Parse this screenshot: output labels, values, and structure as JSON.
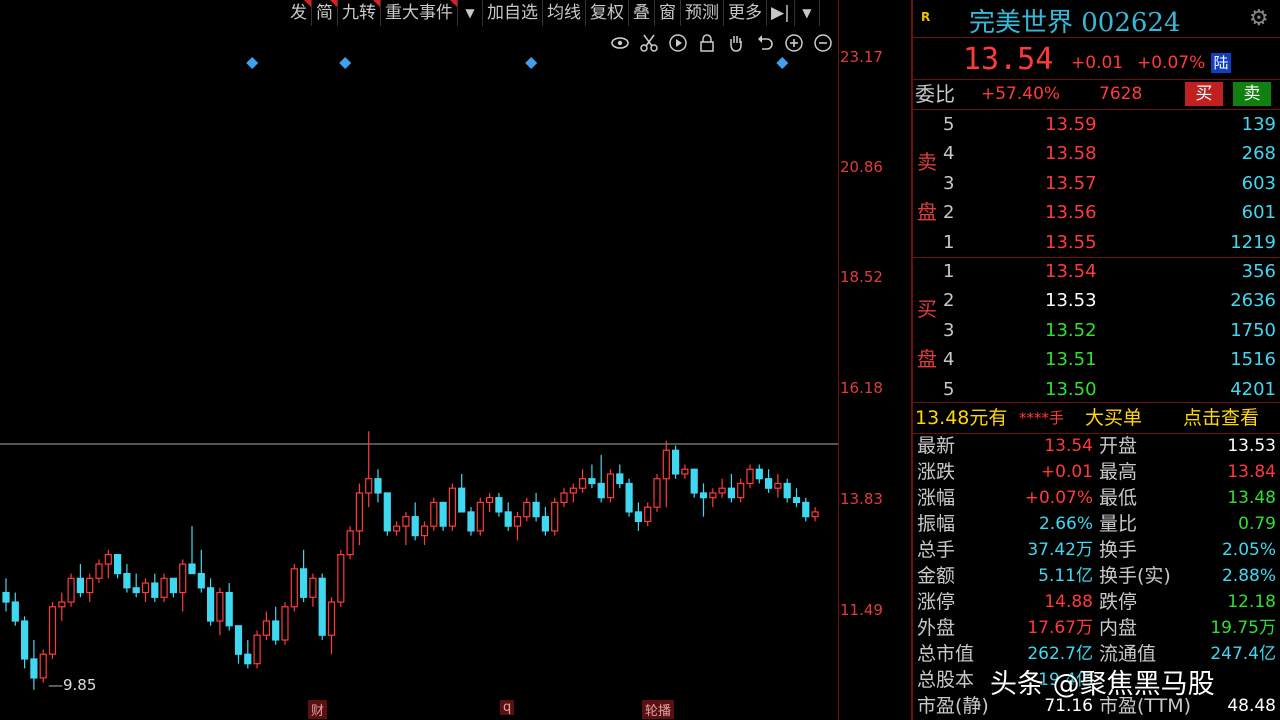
{
  "toolbar": {
    "buttons": [
      {
        "label": "发",
        "flag": true
      },
      {
        "label": "简",
        "flag": true
      },
      {
        "label": "九转",
        "flag": true
      },
      {
        "label": "重大事件",
        "flag": true
      },
      {
        "label": "▼",
        "flag": false
      },
      {
        "label": "加自选",
        "flag": false
      },
      {
        "label": "均线",
        "flag": false
      },
      {
        "label": "复权",
        "flag": false
      },
      {
        "label": "叠",
        "flag": false
      },
      {
        "label": "窗",
        "flag": false
      },
      {
        "label": "预测",
        "flag": false
      },
      {
        "label": "更多",
        "flag": false
      },
      {
        "label": "▶|",
        "flag": false
      },
      {
        "label": "▼",
        "flag": false
      }
    ],
    "tool_icons": [
      "eye-icon",
      "scissors-icon",
      "play-icon",
      "lock-icon",
      "hand-icon",
      "undo-icon",
      "zoom-in-icon",
      "zoom-out-icon"
    ]
  },
  "chart": {
    "price_ticks": [
      "23.17",
      "20.86",
      "18.52",
      "16.18",
      "13.83",
      "11.49"
    ],
    "low_marker": "9.85",
    "x_markers": [
      "财",
      "q",
      "轮播"
    ],
    "colors": {
      "up": "#ff3a3a",
      "down": "#40d8f0",
      "marker": "#40a0f0",
      "axis": "#e03c3c"
    }
  },
  "chart_data": {
    "type": "candlestick",
    "ylim": [
      9.5,
      23.5
    ],
    "candles": [
      [
        11.9,
        12.2,
        11.5,
        11.7
      ],
      [
        11.7,
        11.9,
        11.2,
        11.3
      ],
      [
        11.3,
        11.4,
        10.3,
        10.5
      ],
      [
        10.5,
        10.9,
        9.85,
        10.1
      ],
      [
        10.1,
        10.7,
        10.0,
        10.6
      ],
      [
        10.6,
        11.7,
        10.5,
        11.6
      ],
      [
        11.6,
        11.9,
        11.3,
        11.7
      ],
      [
        11.7,
        12.3,
        11.6,
        12.2
      ],
      [
        12.2,
        12.5,
        11.8,
        11.9
      ],
      [
        11.9,
        12.3,
        11.7,
        12.2
      ],
      [
        12.2,
        12.6,
        12.1,
        12.5
      ],
      [
        12.5,
        12.8,
        12.2,
        12.7
      ],
      [
        12.7,
        12.7,
        12.2,
        12.3
      ],
      [
        12.3,
        12.5,
        11.9,
        12.0
      ],
      [
        12.0,
        12.3,
        11.8,
        11.9
      ],
      [
        11.9,
        12.2,
        11.7,
        12.1
      ],
      [
        12.1,
        12.3,
        11.7,
        11.8
      ],
      [
        11.8,
        12.3,
        11.7,
        12.2
      ],
      [
        12.2,
        12.2,
        11.8,
        11.9
      ],
      [
        11.9,
        12.6,
        11.5,
        12.5
      ],
      [
        12.5,
        13.3,
        12.3,
        12.3
      ],
      [
        12.3,
        12.8,
        11.9,
        12.0
      ],
      [
        12.0,
        12.2,
        11.2,
        11.3
      ],
      [
        11.3,
        12.0,
        11.0,
        11.9
      ],
      [
        11.9,
        12.1,
        11.1,
        11.2
      ],
      [
        11.2,
        11.2,
        10.4,
        10.6
      ],
      [
        10.6,
        10.9,
        10.3,
        10.4
      ],
      [
        10.4,
        11.1,
        10.3,
        11.0
      ],
      [
        11.0,
        11.5,
        10.9,
        11.3
      ],
      [
        11.3,
        11.6,
        10.8,
        10.9
      ],
      [
        10.9,
        11.7,
        10.8,
        11.6
      ],
      [
        11.6,
        12.5,
        11.5,
        12.4
      ],
      [
        12.4,
        12.8,
        11.7,
        11.8
      ],
      [
        11.8,
        12.3,
        11.6,
        12.2
      ],
      [
        12.2,
        12.3,
        10.9,
        11.0
      ],
      [
        11.0,
        11.8,
        10.6,
        11.7
      ],
      [
        11.7,
        12.8,
        11.6,
        12.7
      ],
      [
        12.7,
        13.3,
        12.6,
        13.2
      ],
      [
        13.2,
        14.2,
        12.9,
        14.0
      ],
      [
        14.0,
        15.3,
        13.7,
        14.3
      ],
      [
        14.3,
        14.5,
        13.8,
        14.0
      ],
      [
        14.0,
        14.0,
        13.1,
        13.2
      ],
      [
        13.2,
        13.4,
        13.1,
        13.3
      ],
      [
        13.3,
        13.6,
        12.9,
        13.5
      ],
      [
        13.5,
        13.8,
        13.0,
        13.1
      ],
      [
        13.1,
        13.4,
        12.9,
        13.3
      ],
      [
        13.3,
        13.9,
        13.2,
        13.8
      ],
      [
        13.8,
        13.8,
        13.2,
        13.3
      ],
      [
        13.3,
        14.2,
        13.2,
        14.1
      ],
      [
        14.1,
        14.4,
        13.6,
        13.6
      ],
      [
        13.6,
        13.7,
        13.1,
        13.2
      ],
      [
        13.2,
        13.9,
        13.1,
        13.8
      ],
      [
        13.8,
        14.0,
        13.6,
        13.9
      ],
      [
        13.9,
        14.0,
        13.5,
        13.6
      ],
      [
        13.6,
        13.8,
        13.2,
        13.3
      ],
      [
        13.3,
        13.6,
        13.0,
        13.5
      ],
      [
        13.5,
        13.9,
        13.4,
        13.8
      ],
      [
        13.8,
        14.0,
        13.4,
        13.5
      ],
      [
        13.5,
        13.7,
        13.1,
        13.2
      ],
      [
        13.2,
        13.9,
        13.1,
        13.8
      ],
      [
        13.8,
        14.1,
        13.7,
        14.0
      ],
      [
        14.0,
        14.2,
        13.8,
        14.1
      ],
      [
        14.1,
        14.5,
        14.0,
        14.3
      ],
      [
        14.3,
        14.6,
        14.1,
        14.2
      ],
      [
        14.2,
        14.8,
        13.8,
        13.9
      ],
      [
        13.9,
        14.5,
        13.8,
        14.4
      ],
      [
        14.4,
        14.6,
        14.1,
        14.2
      ],
      [
        14.2,
        14.3,
        13.5,
        13.6
      ],
      [
        13.6,
        13.8,
        13.2,
        13.4
      ],
      [
        13.4,
        13.8,
        13.3,
        13.7
      ],
      [
        13.7,
        14.4,
        13.6,
        14.3
      ],
      [
        14.3,
        15.1,
        13.7,
        14.9
      ],
      [
        14.9,
        15.0,
        14.3,
        14.4
      ],
      [
        14.4,
        14.6,
        14.3,
        14.5
      ],
      [
        14.5,
        14.5,
        13.9,
        14.0
      ],
      [
        14.0,
        14.2,
        13.5,
        13.9
      ],
      [
        13.9,
        14.1,
        13.7,
        14.0
      ],
      [
        14.0,
        14.3,
        13.9,
        14.1
      ],
      [
        14.1,
        14.4,
        13.8,
        13.9
      ],
      [
        13.9,
        14.3,
        13.8,
        14.2
      ],
      [
        14.2,
        14.6,
        14.1,
        14.5
      ],
      [
        14.5,
        14.6,
        14.2,
        14.3
      ],
      [
        14.3,
        14.5,
        14.0,
        14.1
      ],
      [
        14.1,
        14.4,
        13.9,
        14.2
      ],
      [
        14.2,
        14.3,
        13.8,
        13.9
      ],
      [
        13.9,
        14.1,
        13.7,
        13.8
      ],
      [
        13.8,
        13.9,
        13.4,
        13.5
      ],
      [
        13.5,
        13.7,
        13.4,
        13.6
      ]
    ],
    "event_markers": [
      34,
      44,
      64,
      91,
      101,
      104,
      105
    ]
  },
  "panel": {
    "badge": "R",
    "name": "完美世界 002624",
    "price": "13.54",
    "change": "+0.01",
    "change_pct": "+0.07%",
    "market_tag": "陆",
    "weibi_label": "委比",
    "weibi_pct": "+57.40%",
    "weibi_val": "7628",
    "buy_btn": "买",
    "sell_btn": "卖",
    "sell_label_1": "卖",
    "sell_label_2": "盘",
    "buy_label_1": "买",
    "buy_label_2": "盘",
    "asks": [
      {
        "lvl": "5",
        "price": "13.59",
        "vol": "139"
      },
      {
        "lvl": "4",
        "price": "13.58",
        "vol": "268"
      },
      {
        "lvl": "3",
        "price": "13.57",
        "vol": "603"
      },
      {
        "lvl": "2",
        "price": "13.56",
        "vol": "601"
      },
      {
        "lvl": "1",
        "price": "13.55",
        "vol": "1219"
      }
    ],
    "bids": [
      {
        "lvl": "1",
        "price": "13.54",
        "vol": "356"
      },
      {
        "lvl": "2",
        "price": "13.53",
        "vol": "2636"
      },
      {
        "lvl": "3",
        "price": "13.52",
        "vol": "1750"
      },
      {
        "lvl": "4",
        "price": "13.51",
        "vol": "1516"
      },
      {
        "lvl": "5",
        "price": "13.50",
        "vol": "4201"
      }
    ],
    "big_order": {
      "price": "13.48元有",
      "stars": "****手",
      "label": "大买单",
      "link": "点击查看"
    },
    "stats": [
      {
        "l1": "最新",
        "v1": "13.54",
        "c1": "red",
        "l2": "开盘",
        "v2": "13.53",
        "c2": "white"
      },
      {
        "l1": "涨跌",
        "v1": "+0.01",
        "c1": "red",
        "l2": "最高",
        "v2": "13.84",
        "c2": "red"
      },
      {
        "l1": "涨幅",
        "v1": "+0.07%",
        "c1": "red",
        "l2": "最低",
        "v2": "13.48",
        "c2": "green"
      },
      {
        "l1": "振幅",
        "v1": "2.66%",
        "c1": "cyan",
        "l2": "量比",
        "v2": "0.79",
        "c2": "green"
      },
      {
        "l1": "总手",
        "v1": "37.42万",
        "c1": "cyan",
        "l2": "换手",
        "v2": "2.05%",
        "c2": "cyan"
      },
      {
        "l1": "金额",
        "v1": "5.11亿",
        "c1": "cyan",
        "l2": "换手(实)",
        "v2": "2.88%",
        "c2": "cyan"
      },
      {
        "l1": "涨停",
        "v1": "14.88",
        "c1": "red",
        "l2": "跌停",
        "v2": "12.18",
        "c2": "green"
      },
      {
        "l1": "外盘",
        "v1": "17.67万",
        "c1": "red",
        "l2": "内盘",
        "v2": "19.75万",
        "c2": "green"
      },
      {
        "l1": "总市值",
        "v1": "262.7亿",
        "c1": "cyan",
        "l2": "流通值",
        "v2": "247.4亿",
        "c2": "cyan"
      },
      {
        "l1": "总股本",
        "v1": "19.4亿",
        "c1": "cyan",
        "l2": "",
        "v2": "",
        "c2": "cyan"
      },
      {
        "l1": "市盈(静)",
        "v1": "71.16",
        "c1": "white",
        "l2": "市盈(TTM)",
        "v2": "48.48",
        "c2": "white"
      }
    ]
  },
  "watermark": "头条 @聚焦黑马股"
}
